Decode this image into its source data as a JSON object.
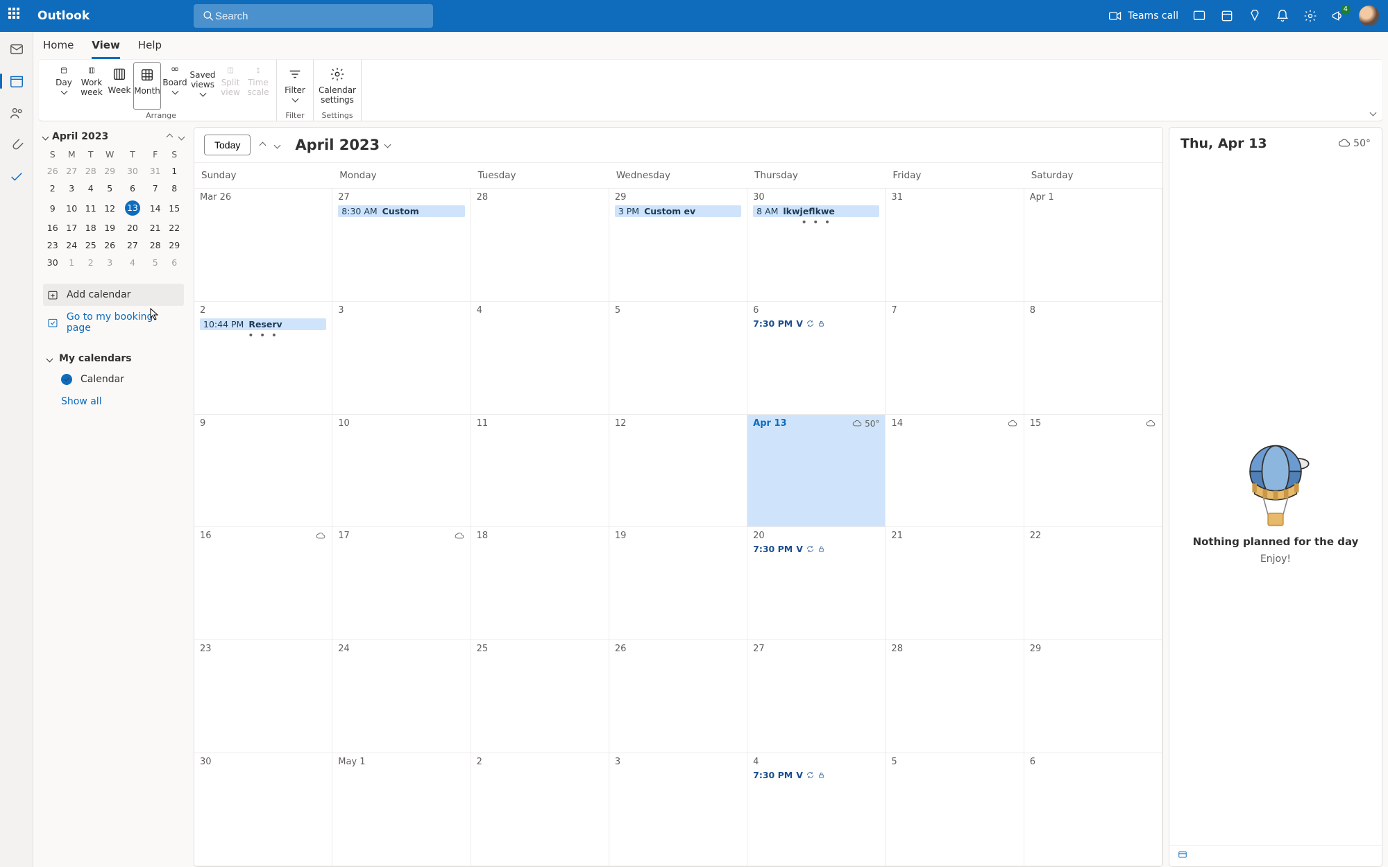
{
  "titlebar": {
    "brand": "Outlook",
    "search_placeholder": "Search",
    "teams_call": "Teams call",
    "notification_badge": "4"
  },
  "tabs": {
    "home": "Home",
    "view": "View",
    "help": "Help",
    "active": "view"
  },
  "ribbon": {
    "day": "Day",
    "work_week": "Work week",
    "week": "Week",
    "month": "Month",
    "board": "Board",
    "saved_views": "Saved views",
    "split_view": "Split view",
    "time_scale": "Time scale",
    "filter": "Filter",
    "cal_settings": "Calendar settings",
    "group_arrange": "Arrange",
    "group_filter": "Filter",
    "group_settings": "Settings"
  },
  "minical": {
    "title": "April 2023",
    "dows": [
      "S",
      "M",
      "T",
      "W",
      "T",
      "F",
      "S"
    ],
    "rows": [
      [
        "26",
        "27",
        "28",
        "29",
        "30",
        "31",
        "1"
      ],
      [
        "2",
        "3",
        "4",
        "5",
        "6",
        "7",
        "8"
      ],
      [
        "9",
        "10",
        "11",
        "12",
        "13",
        "14",
        "15"
      ],
      [
        "16",
        "17",
        "18",
        "19",
        "20",
        "21",
        "22"
      ],
      [
        "23",
        "24",
        "25",
        "26",
        "27",
        "28",
        "29"
      ],
      [
        "30",
        "1",
        "2",
        "3",
        "4",
        "5",
        "6"
      ]
    ]
  },
  "side": {
    "add_calendar": "Add calendar",
    "booking": "Go to my booking page",
    "my_calendars": "My calendars",
    "calendar": "Calendar",
    "show_all": "Show all"
  },
  "calendar": {
    "today_btn": "Today",
    "title": "April 2023",
    "dows": [
      "Sunday",
      "Monday",
      "Tuesday",
      "Wednesday",
      "Thursday",
      "Friday",
      "Saturday"
    ],
    "weeks": [
      {
        "cells": [
          {
            "label": "Mar 26"
          },
          {
            "label": "27",
            "events": [
              {
                "time": "8:30 AM",
                "title": "Custom"
              }
            ]
          },
          {
            "label": "28"
          },
          {
            "label": "29",
            "events": [
              {
                "time": "3 PM",
                "title": "Custom ev"
              }
            ]
          },
          {
            "label": "30",
            "events": [
              {
                "time": "8 AM",
                "title": "lkwjeflkwe"
              }
            ],
            "more": true
          },
          {
            "label": "31"
          },
          {
            "label": "Apr 1"
          }
        ]
      },
      {
        "cells": [
          {
            "label": "2",
            "events": [
              {
                "time": "10:44 PM",
                "title": "Reserv"
              }
            ],
            "more": true
          },
          {
            "label": "3"
          },
          {
            "label": "4"
          },
          {
            "label": "5"
          },
          {
            "label": "6",
            "plain": [
              {
                "time": "7:30 PM",
                "title": "V"
              }
            ]
          },
          {
            "label": "7"
          },
          {
            "label": "8"
          }
        ]
      },
      {
        "cells": [
          {
            "label": "9"
          },
          {
            "label": "10"
          },
          {
            "label": "11"
          },
          {
            "label": "12"
          },
          {
            "label": "Apr 13",
            "today": true,
            "weather": "50°"
          },
          {
            "label": "14",
            "weather": ""
          },
          {
            "label": "15",
            "weather": ""
          }
        ]
      },
      {
        "cells": [
          {
            "label": "16",
            "weather": ""
          },
          {
            "label": "17",
            "weather": ""
          },
          {
            "label": "18"
          },
          {
            "label": "19"
          },
          {
            "label": "20",
            "plain": [
              {
                "time": "7:30 PM",
                "title": "V"
              }
            ]
          },
          {
            "label": "21"
          },
          {
            "label": "22"
          }
        ]
      },
      {
        "cells": [
          {
            "label": "23"
          },
          {
            "label": "24"
          },
          {
            "label": "25"
          },
          {
            "label": "26"
          },
          {
            "label": "27"
          },
          {
            "label": "28"
          },
          {
            "label": "29"
          }
        ]
      },
      {
        "cells": [
          {
            "label": "30"
          },
          {
            "label": "May 1"
          },
          {
            "label": "2"
          },
          {
            "label": "3"
          },
          {
            "label": "4",
            "plain": [
              {
                "time": "7:30 PM",
                "title": "V"
              }
            ]
          },
          {
            "label": "5"
          },
          {
            "label": "6"
          }
        ]
      }
    ]
  },
  "daypanel": {
    "title": "Thu, Apr 13",
    "weather": "50°",
    "empty_title": "Nothing planned for the day",
    "empty_sub": "Enjoy!"
  }
}
